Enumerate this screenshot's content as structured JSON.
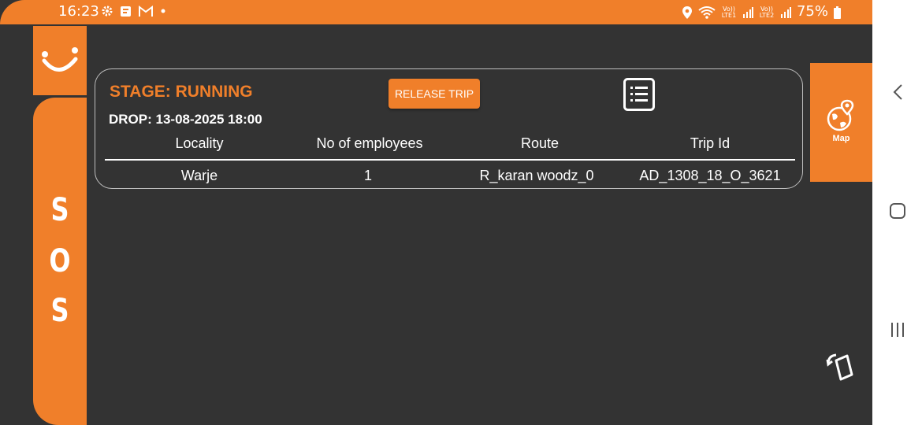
{
  "status_bar": {
    "time": "16:23",
    "battery": "75%",
    "sim1_label": "Vo)) LTE1",
    "sim2_label": "Vo)) LTE2",
    "left_icons": [
      "settings-icon",
      "notification-icon",
      "gmail-icon",
      "dot-icon"
    ],
    "right_icons": [
      "location-icon",
      "wifi-icon",
      "signal-icon",
      "battery-icon"
    ]
  },
  "sidebar": {
    "logo_icon": "smile-logo-icon",
    "sos_letters": [
      "S",
      "O",
      "S"
    ]
  },
  "trip": {
    "stage": "STAGE: RUNNING",
    "drop": "DROP: 13-08-2025 18:00",
    "release_button": "RELEASE TRIP",
    "list_icon": "list-icon",
    "table": {
      "headers": [
        "Locality",
        "No of employees",
        "Route",
        "Trip Id"
      ],
      "rows": [
        [
          "Warje",
          "1",
          "R_karan woodz_0",
          "AD_1308_18_O_3621"
        ]
      ]
    }
  },
  "map_button": {
    "label": "Map",
    "icon": "map-globe-icon"
  },
  "rotate_icon": "rotate-screen-icon",
  "nav_bar": {
    "icons": [
      "back-icon",
      "home-icon",
      "recents-icon"
    ]
  },
  "colors": {
    "accent": "#f07f2a",
    "background": "#333333",
    "text": "#ffffff"
  }
}
